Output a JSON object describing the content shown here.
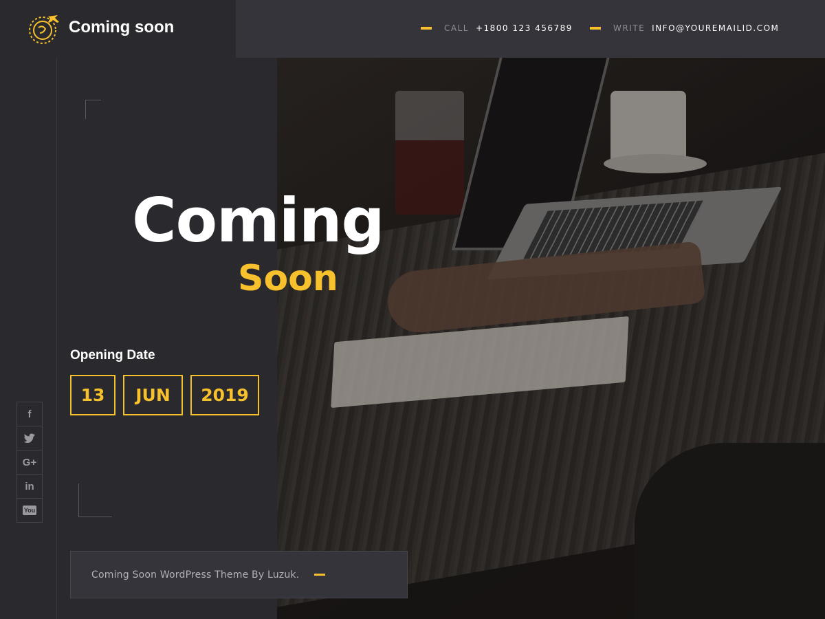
{
  "brand": {
    "name": "Coming soon",
    "logo_icon": "globe-plane-icon",
    "accent": "#f7c12d"
  },
  "contact": {
    "call_label": "CALL",
    "call_value": "+1800 123 456789",
    "write_label": "WRITE",
    "write_value": "INFO@YOUREMAILID.COM"
  },
  "hero": {
    "line1": "Coming",
    "line2": "Soon"
  },
  "opening": {
    "label": "Opening Date",
    "day": "13",
    "month": "JUN",
    "year": "2019"
  },
  "social": [
    {
      "name": "facebook-icon",
      "glyph": "f"
    },
    {
      "name": "twitter-icon",
      "glyph": "🐦"
    },
    {
      "name": "google-plus-icon",
      "glyph": "G+"
    },
    {
      "name": "linkedin-icon",
      "glyph": "in"
    },
    {
      "name": "youtube-icon",
      "glyph": "You"
    }
  ],
  "footer": {
    "text": "Coming Soon WordPress Theme By Luzuk."
  }
}
